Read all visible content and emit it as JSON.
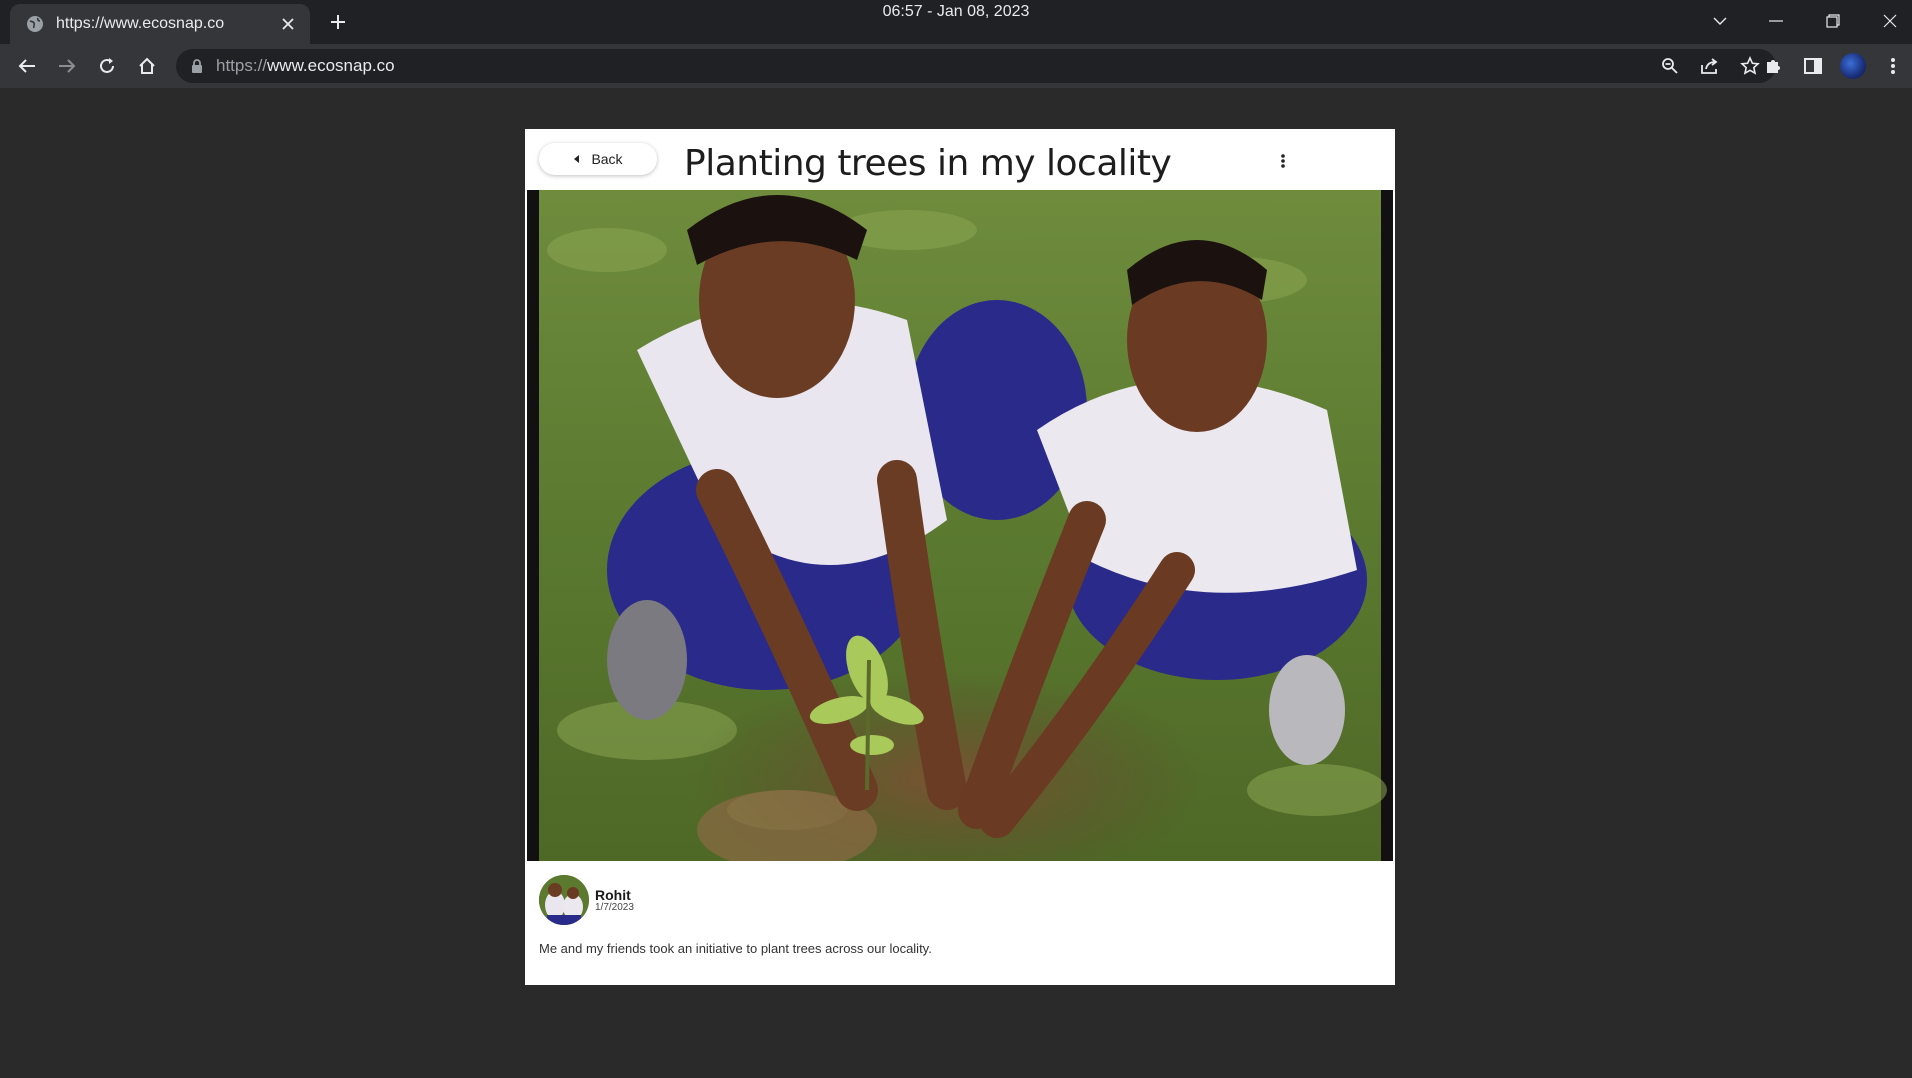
{
  "browser": {
    "tab_title": "https://www.ecosnap.co",
    "clock": "06:57 - Jan 08, 2023",
    "url_scheme": "https://",
    "url_host": "www.ecosnap.co"
  },
  "post": {
    "back_label": "Back",
    "title": "Planting trees in my locality",
    "author_name": "Rohit",
    "author_date": "1/7/2023",
    "caption": "Me and my friends took an initiative to plant trees across our locality."
  },
  "icons": {
    "tab": [
      "globe-icon",
      "close-icon",
      "plus-icon"
    ],
    "window": [
      "chevron-down-icon",
      "minimize-icon",
      "restore-icon",
      "close-icon"
    ],
    "nav": [
      "arrow-left-icon",
      "arrow-right-icon",
      "reload-icon",
      "home-icon"
    ],
    "omnibox": [
      "lock-icon",
      "zoom-icon",
      "share-icon",
      "star-icon"
    ],
    "toolbar": [
      "puzzle-icon",
      "side-panel-icon",
      "profile-avatar",
      "kebab-menu-icon"
    ],
    "page": [
      "caret-left-icon",
      "more-vertical-icon"
    ]
  }
}
